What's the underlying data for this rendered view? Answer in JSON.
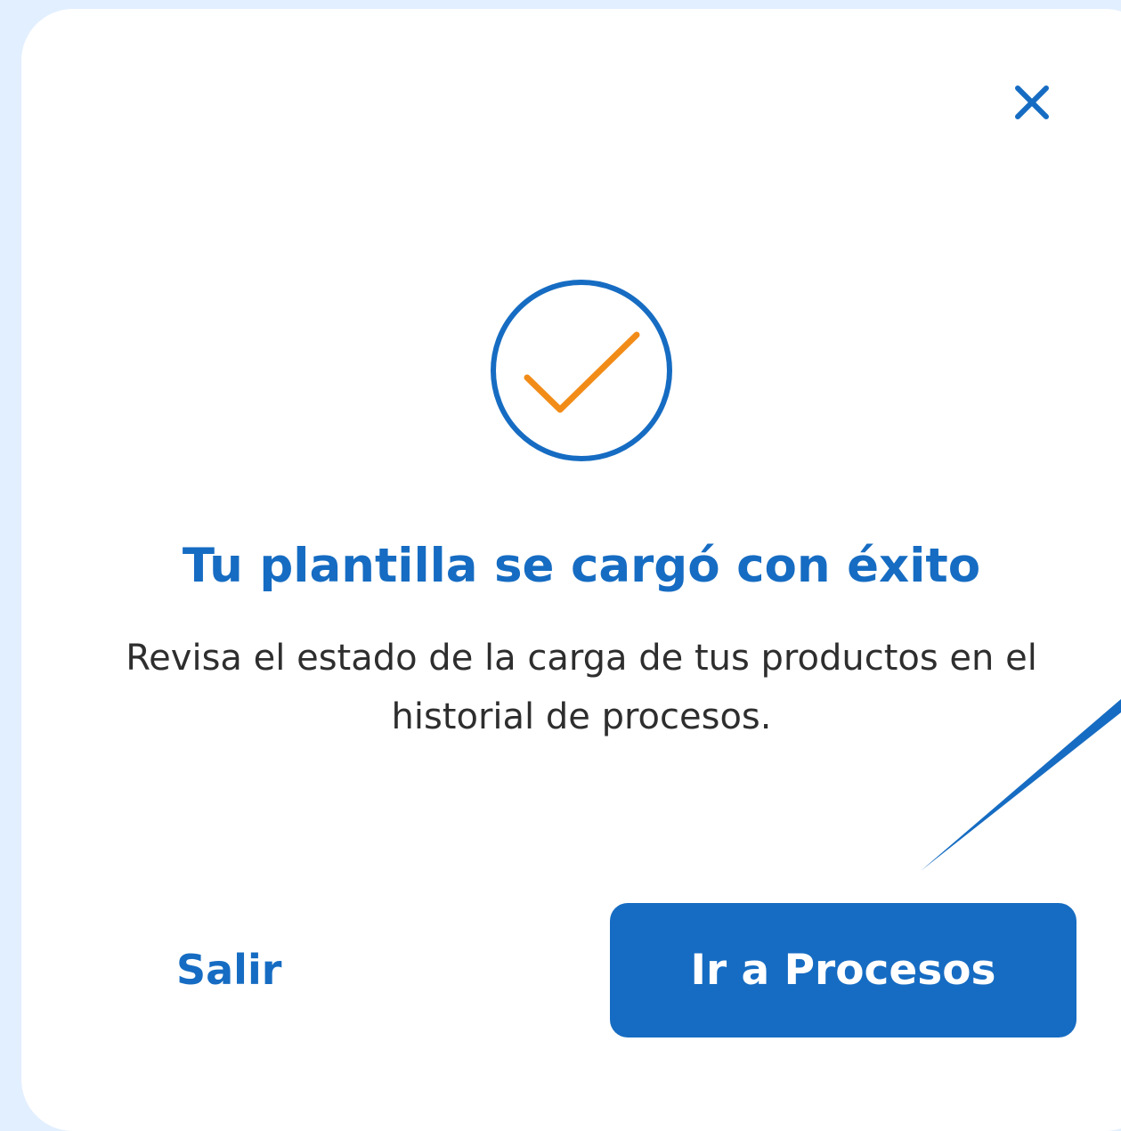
{
  "dialog": {
    "title": "Tu plantilla se cargó con éxito",
    "message": "Revisa el estado de la carga de tus productos en el historial de procesos.",
    "close_icon": "close-icon",
    "status_icon": "check-circle-icon"
  },
  "actions": {
    "secondary_label": "Salir",
    "primary_label": "Ir a Procesos"
  },
  "colors": {
    "background": "#e2efff",
    "surface": "#ffffff",
    "primary": "#166cc2",
    "check": "#f28c18",
    "text": "#2e2e2e"
  }
}
